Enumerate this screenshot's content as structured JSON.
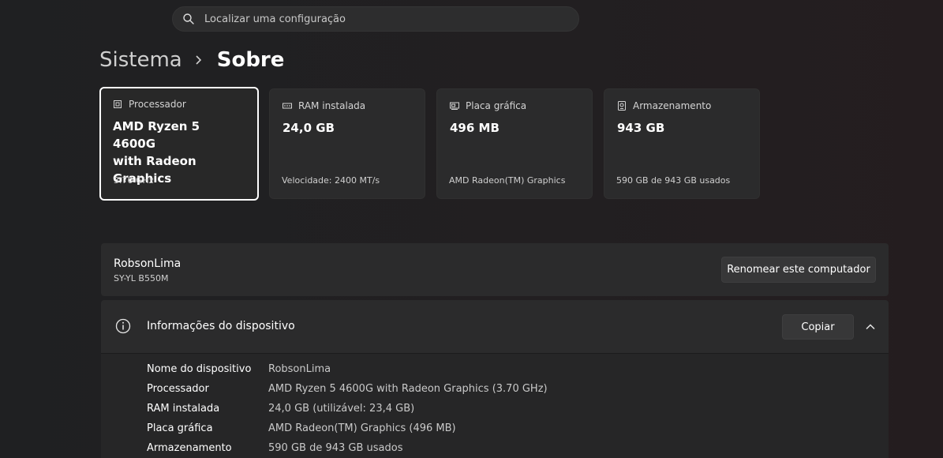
{
  "search": {
    "placeholder": "Localizar uma configuração",
    "icon": "search-icon"
  },
  "breadcrumb": {
    "parent": "Sistema",
    "current": "Sobre"
  },
  "cards": [
    {
      "label": "Processador",
      "icon": "processor-icon",
      "value_line1": "AMD Ryzen 5 4600G",
      "value_line2": "with Radeon Graphics",
      "detail": "3.70 GHz",
      "selected": true
    },
    {
      "label": "RAM instalada",
      "icon": "ram-icon",
      "value_line1": "24,0 GB",
      "value_line2": "",
      "detail": "Velocidade: 2400 MT/s",
      "selected": false
    },
    {
      "label": "Placa gráfica",
      "icon": "gpu-icon",
      "value_line1": "496 MB",
      "value_line2": "",
      "detail": "AMD Radeon(TM) Graphics",
      "selected": false
    },
    {
      "label": "Armazenamento",
      "icon": "storage-icon",
      "value_line1": "943 GB",
      "value_line2": "",
      "detail": "590 GB de 943 GB usados",
      "selected": false
    }
  ],
  "computer": {
    "name": "RobsonLima",
    "model": "SY-YL B550M",
    "rename_label": "Renomear este computador"
  },
  "device_info": {
    "title": "Informações do dispositivo",
    "copy_label": "Copiar",
    "rows": [
      {
        "key": "Nome do dispositivo",
        "value": "RobsonLima"
      },
      {
        "key": "Processador",
        "value": "AMD Ryzen 5 4600G with Radeon Graphics (3.70 GHz)"
      },
      {
        "key": "RAM instalada",
        "value": "24,0 GB (utilizável: 23,4 GB)"
      },
      {
        "key": "Placa gráfica",
        "value": "AMD Radeon(TM) Graphics (496 MB)"
      },
      {
        "key": "Armazenamento",
        "value": "590 GB de 943 GB usados"
      }
    ]
  }
}
